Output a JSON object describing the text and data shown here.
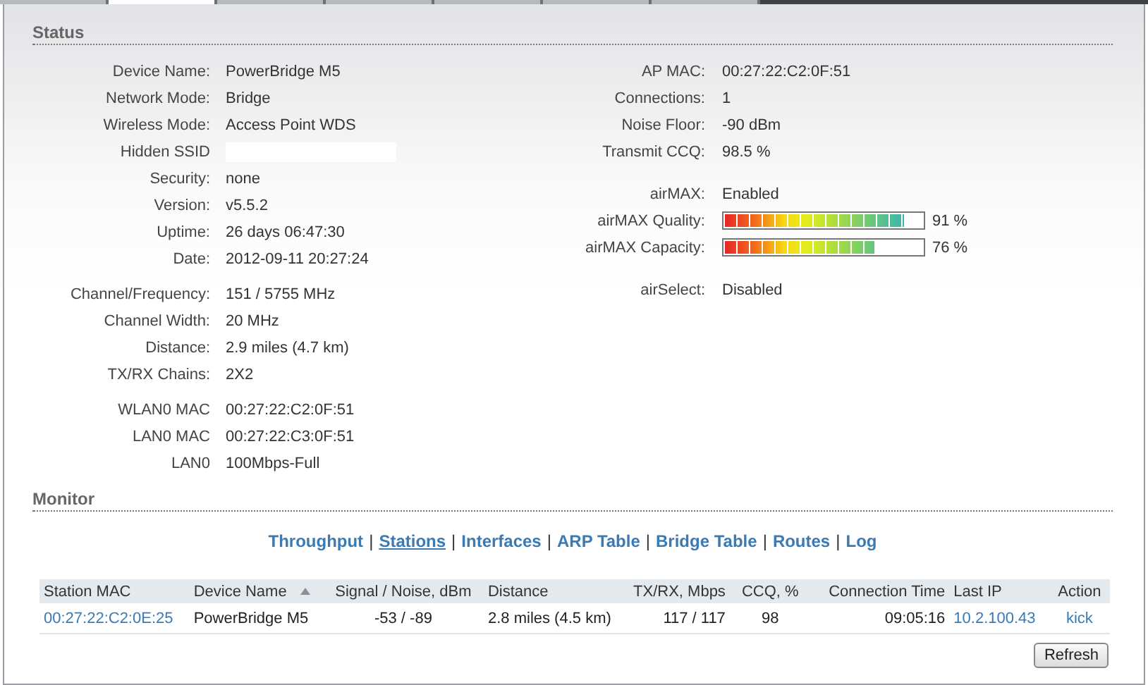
{
  "tabs": [
    {
      "selected": false
    },
    {
      "selected": true
    },
    {
      "selected": false
    },
    {
      "selected": false
    },
    {
      "selected": false
    },
    {
      "selected": false
    },
    {
      "selected": false
    }
  ],
  "status": {
    "title": "Status",
    "left_groups": [
      [
        {
          "label": "Device Name:",
          "value": "PowerBridge M5"
        },
        {
          "label": "Network Mode:",
          "value": "Bridge"
        },
        {
          "label": "Wireless Mode:",
          "value": "Access Point WDS"
        },
        {
          "label": "Hidden SSID",
          "kind": "blank"
        },
        {
          "label": "Security:",
          "value": "none"
        },
        {
          "label": "Version:",
          "value": "v5.5.2"
        },
        {
          "label": "Uptime:",
          "value": "26 days 06:47:30"
        },
        {
          "label": "Date:",
          "value": "2012-09-11 20:27:24"
        }
      ],
      [
        {
          "label": "Channel/Frequency:",
          "value": "151 / 5755 MHz"
        },
        {
          "label": "Channel Width:",
          "value": "20 MHz"
        },
        {
          "label": "Distance:",
          "value": "2.9 miles (4.7 km)"
        },
        {
          "label": "TX/RX Chains:",
          "value": "2X2"
        }
      ],
      [
        {
          "label": "WLAN0 MAC",
          "value": "00:27:22:C2:0F:51"
        },
        {
          "label": "LAN0 MAC",
          "value": "00:27:22:C3:0F:51"
        },
        {
          "label": "LAN0",
          "value": "100Mbps-Full"
        }
      ]
    ],
    "right_groups": [
      [
        {
          "label": "AP MAC:",
          "value": "00:27:22:C2:0F:51"
        },
        {
          "label": "Connections:",
          "value": "1"
        },
        {
          "label": "Noise Floor:",
          "value": "-90 dBm"
        },
        {
          "label": "Transmit CCQ:",
          "value": "98.5 %"
        }
      ],
      [
        {
          "label": "airMAX:",
          "value": "Enabled"
        },
        {
          "label": "airMAX Quality:",
          "kind": "meter",
          "level": 0.91,
          "reading": "91 %"
        },
        {
          "label": "airMAX Capacity:",
          "kind": "meter",
          "level": 0.76,
          "reading": "76 %"
        }
      ],
      [
        {
          "label": "airSelect:",
          "value": "Disabled"
        }
      ]
    ]
  },
  "monitor": {
    "title": "Monitor",
    "links": [
      {
        "label": "Throughput",
        "selected": false
      },
      {
        "label": "Stations",
        "selected": true
      },
      {
        "label": "Interfaces",
        "selected": false
      },
      {
        "label": "ARP Table",
        "selected": false
      },
      {
        "label": "Bridge Table",
        "selected": false
      },
      {
        "label": "Routes",
        "selected": false
      },
      {
        "label": "Log",
        "selected": false
      }
    ],
    "separator": "|",
    "table": {
      "columns": [
        {
          "label": "Station MAC",
          "sorted": false
        },
        {
          "label": "Device Name",
          "sorted": true
        },
        {
          "label": "Signal / Noise, dBm",
          "sorted": false
        },
        {
          "label": "Distance",
          "sorted": false
        },
        {
          "label": "TX/RX, Mbps",
          "sorted": false
        },
        {
          "label": "CCQ, %",
          "sorted": false
        },
        {
          "label": "Connection Time",
          "sorted": false
        },
        {
          "label": "Last IP",
          "sorted": false
        },
        {
          "label": "Action",
          "sorted": false
        }
      ],
      "rows": [
        [
          {
            "text": "00:27:22:C2:0E:25",
            "link": true
          },
          {
            "text": "PowerBridge M5"
          },
          {
            "text": "-53 / -89"
          },
          {
            "text": "2.8 miles (4.5 km)"
          },
          {
            "text": "117 / 117"
          },
          {
            "text": "98"
          },
          {
            "text": "09:05:16"
          },
          {
            "text": "10.2.100.43",
            "link": true
          },
          {
            "text": "kick",
            "link": true
          }
        ]
      ]
    },
    "refresh_button": "Refresh"
  }
}
